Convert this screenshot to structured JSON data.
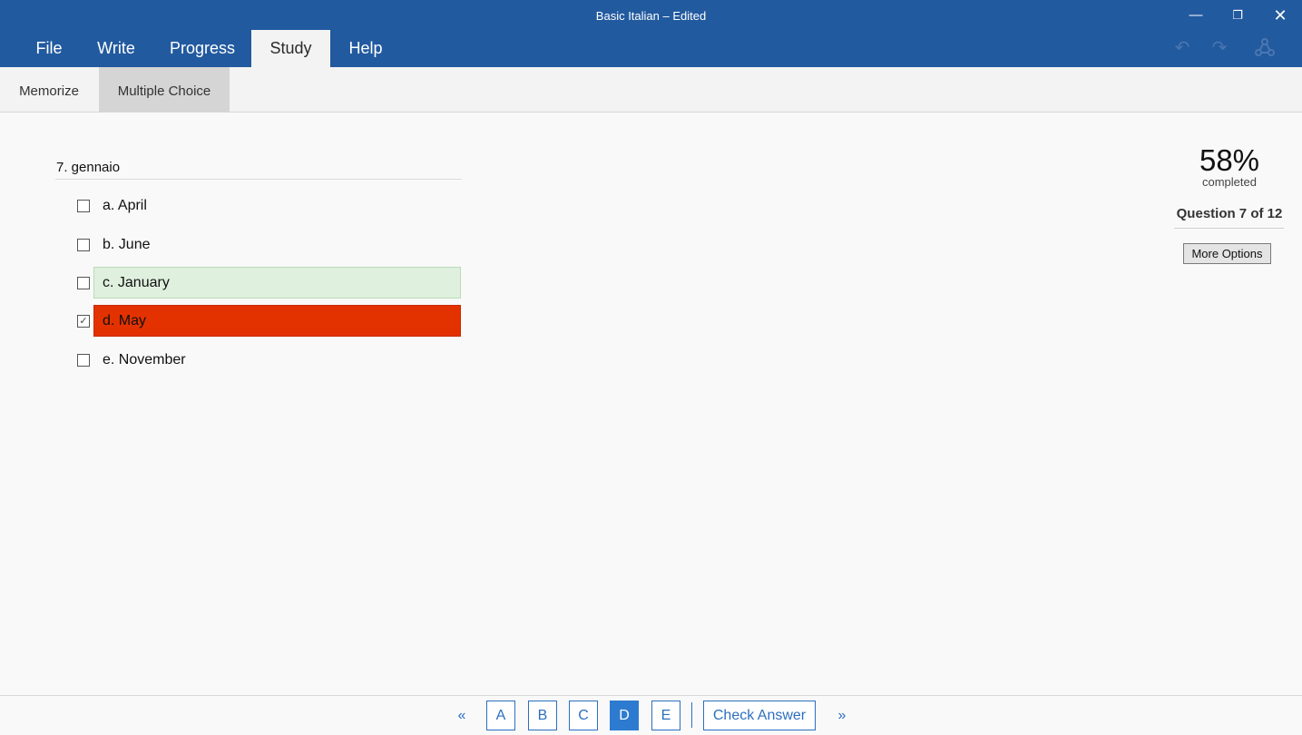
{
  "window": {
    "title": "Basic Italian – Edited",
    "minimize_icon": "minimize-icon",
    "maximize_icon": "restore-icon",
    "close_icon": "close-icon"
  },
  "menu": {
    "tabs": [
      {
        "label": "File"
      },
      {
        "label": "Write"
      },
      {
        "label": "Progress"
      },
      {
        "label": "Study",
        "active": true
      },
      {
        "label": "Help"
      }
    ]
  },
  "quick_access": {
    "undo_icon": "undo-icon",
    "redo_icon": "redo-icon",
    "share_icon": "share-icon"
  },
  "study_toolbar": {
    "tabs": [
      {
        "label": "Memorize"
      },
      {
        "label": "Multiple Choice",
        "active": true
      }
    ]
  },
  "question": {
    "text": "7. gennaio",
    "choices": [
      {
        "label": "a. April",
        "checked": false,
        "state": "none"
      },
      {
        "label": "b. June",
        "checked": false,
        "state": "none"
      },
      {
        "label": "c. January",
        "checked": false,
        "state": "correct"
      },
      {
        "label": "d. May",
        "checked": true,
        "state": "wrong"
      },
      {
        "label": "e. November",
        "checked": false,
        "state": "none"
      }
    ]
  },
  "progress": {
    "percent": "58%",
    "percent_label": "completed",
    "question_counter": "Question 7 of 12",
    "more_options_label": "More Options"
  },
  "bottom_nav": {
    "prev_label": "«",
    "next_label": "»",
    "letters": [
      "A",
      "B",
      "C",
      "D",
      "E"
    ],
    "selected_letter": "D",
    "check_label": "Check Answer"
  },
  "colors": {
    "titlebar": "#225a9f",
    "correct_bg": "#dff0de",
    "wrong_bg": "#e33200",
    "accent": "#2c6fc0"
  }
}
